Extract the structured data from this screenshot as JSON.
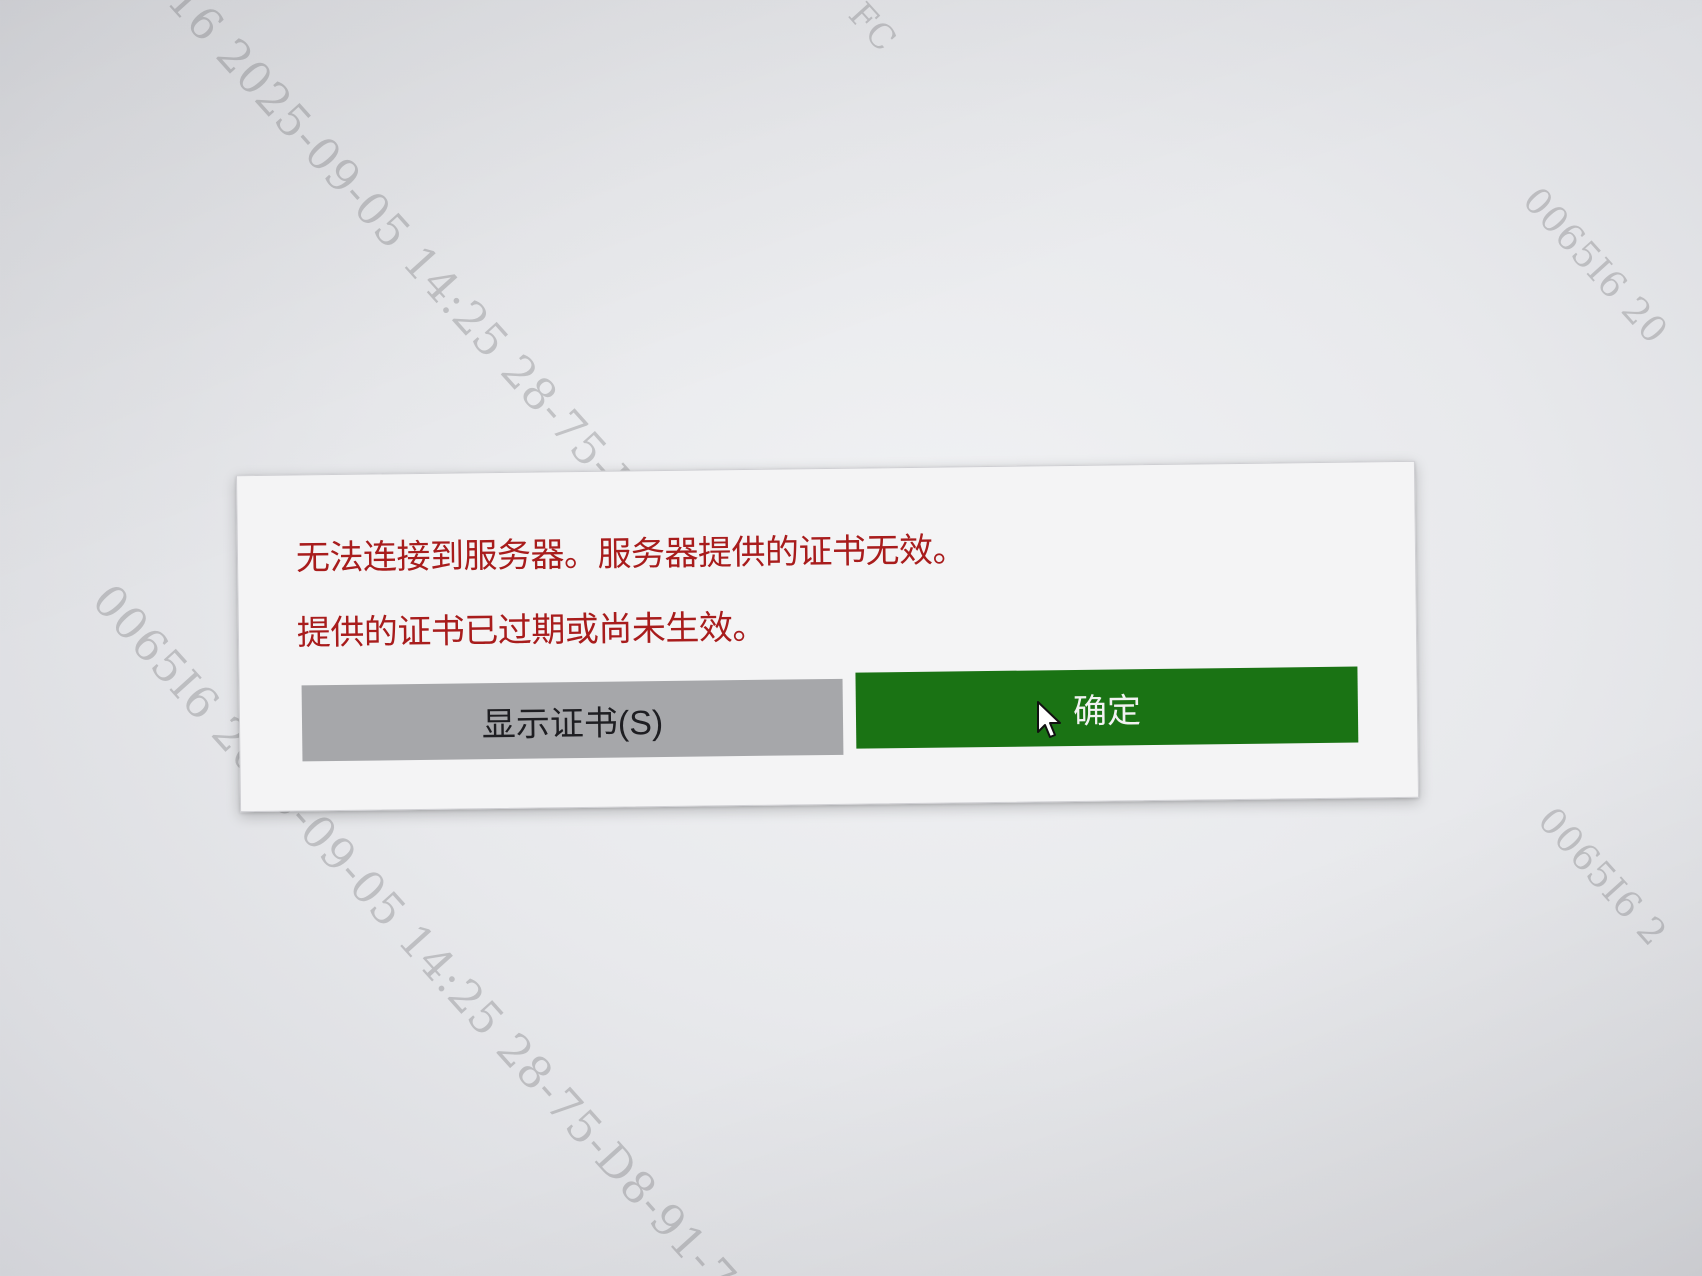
{
  "dialog": {
    "error_line_1": "无法连接到服务器。服务器提供的证书无效。",
    "error_line_2": "提供的证书已过期或尚未生效。",
    "show_certificate_label": "显示证书(S)",
    "ok_label": "确定"
  },
  "watermark": {
    "line_1": "16 2025-09-05 14:25 28-75-D8-",
    "line_2": "0065I6 2025-09-05 14:25 28-75-D8-91-7",
    "line_3": "0065I6 20",
    "line_4": "0065I6 2",
    "line_5": "FC"
  },
  "colors": {
    "error_text": "#a81c1c",
    "ok_button": "#1a7314",
    "cert_button": "#a6a7aa",
    "dialog_bg": "#f4f4f5"
  },
  "icons": {
    "cursor": "mouse-pointer-icon"
  }
}
